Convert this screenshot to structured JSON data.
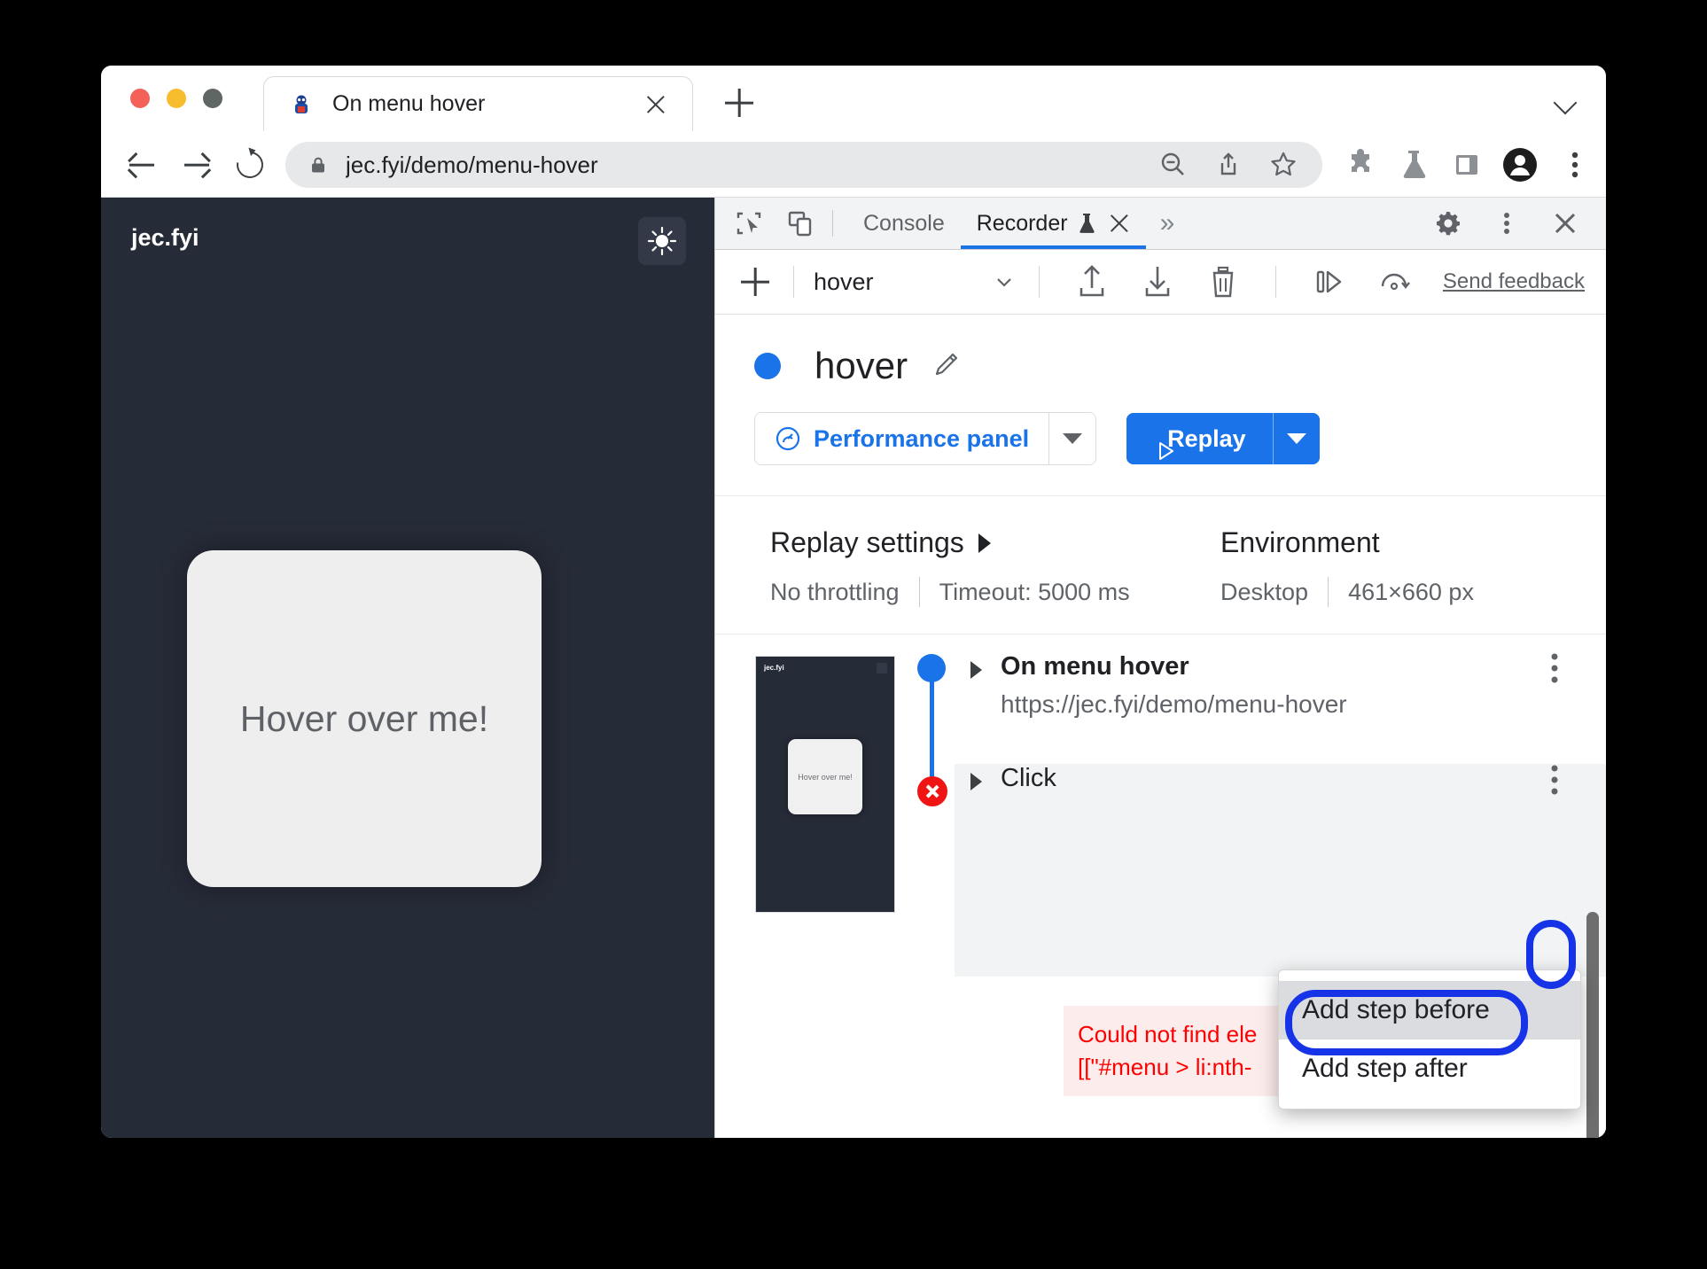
{
  "browser": {
    "tab": {
      "title": "On menu hover",
      "favicon_name": "site-favicon",
      "close_label": "×"
    },
    "new_tab_label": "+",
    "tabstrip_expander_name": "tab-search-chevron",
    "toolbar": {
      "back_label": "Back",
      "forward_label": "Forward",
      "reload_label": "Reload",
      "url": "jec.fyi/demo/menu-hover",
      "lock_label": "Secure",
      "omnibox_actions": [
        "zoom-out-icon",
        "share-icon",
        "bookmark-star-icon"
      ],
      "right_icons": [
        "extensions-puzzle-icon",
        "experiments-flask-icon",
        "side-panel-icon",
        "profile-avatar-icon",
        "chrome-menu-icon"
      ]
    }
  },
  "page": {
    "logo": "jec.fyi",
    "theme_toggle_name": "sun-icon",
    "card_text": "Hover over me!",
    "background_color": "#262b38",
    "card_color": "#eeeeee"
  },
  "devtools": {
    "tabs": [
      {
        "label": "Console",
        "active": false
      },
      {
        "label": "Recorder",
        "active": true
      }
    ],
    "recorder_has_flask": true,
    "recorder_close_label": "×",
    "more_tabs_label": "»",
    "inspect_icon_name": "inspect-element-icon",
    "device_icon_name": "device-toolbar-icon",
    "right_icons": [
      "settings-gear-icon",
      "devtools-more-icon",
      "devtools-close-icon"
    ]
  },
  "recorder": {
    "toolbar": {
      "add_label": "+",
      "selected_recording": "hover",
      "dropdown_name": "recording-select-chevron",
      "import_name": "import-recording-icon",
      "export_name": "export-recording-icon",
      "delete_name": "delete-recording-icon",
      "step_by_step_name": "replay-step-by-step-icon",
      "slow_replay_name": "replay-speed-icon",
      "feedback_label": "Send feedback"
    },
    "header": {
      "title": "hover",
      "dot_color": "#1a73e8",
      "edit_name": "edit-title-icon",
      "perf_button_label": "Performance panel",
      "perf_icon_name": "performance-gauge-icon",
      "perf_split_name": "performance-options-chevron",
      "replay_button_label": "Replay",
      "replay_icon_name": "play-triangle-icon",
      "replay_split_name": "replay-options-chevron",
      "accent_color": "#1a73e8"
    },
    "settings": {
      "replay_heading": "Replay settings",
      "throttling": "No throttling",
      "timeout": "Timeout: 5000 ms",
      "environment_heading": "Environment",
      "device": "Desktop",
      "viewport": "461×660 px"
    },
    "steps": [
      {
        "label": "On menu hover",
        "sub": "https://jec.fyi/demo/menu-hover",
        "status": "ok",
        "menu_name": "step-options-icon"
      },
      {
        "label": "Click",
        "sub": "",
        "status": "error",
        "menu_name": "step-options-icon"
      }
    ],
    "error": {
      "line1": "Could not find ele",
      "line2": "[[\"#menu > li:nth-",
      "color": "#ff0000",
      "background": "#fdecec"
    },
    "thumbnail": {
      "logo": "jec.fyi",
      "card_text": "Hover over me!"
    },
    "context_menu": {
      "items": [
        {
          "label": "Add step before",
          "highlighted": true
        },
        {
          "label": "Add step after",
          "highlighted": false
        }
      ]
    }
  },
  "annotations": {
    "ring_color": "#1633e8",
    "targets": [
      "step-options-icon",
      "add-step-before-item"
    ]
  }
}
